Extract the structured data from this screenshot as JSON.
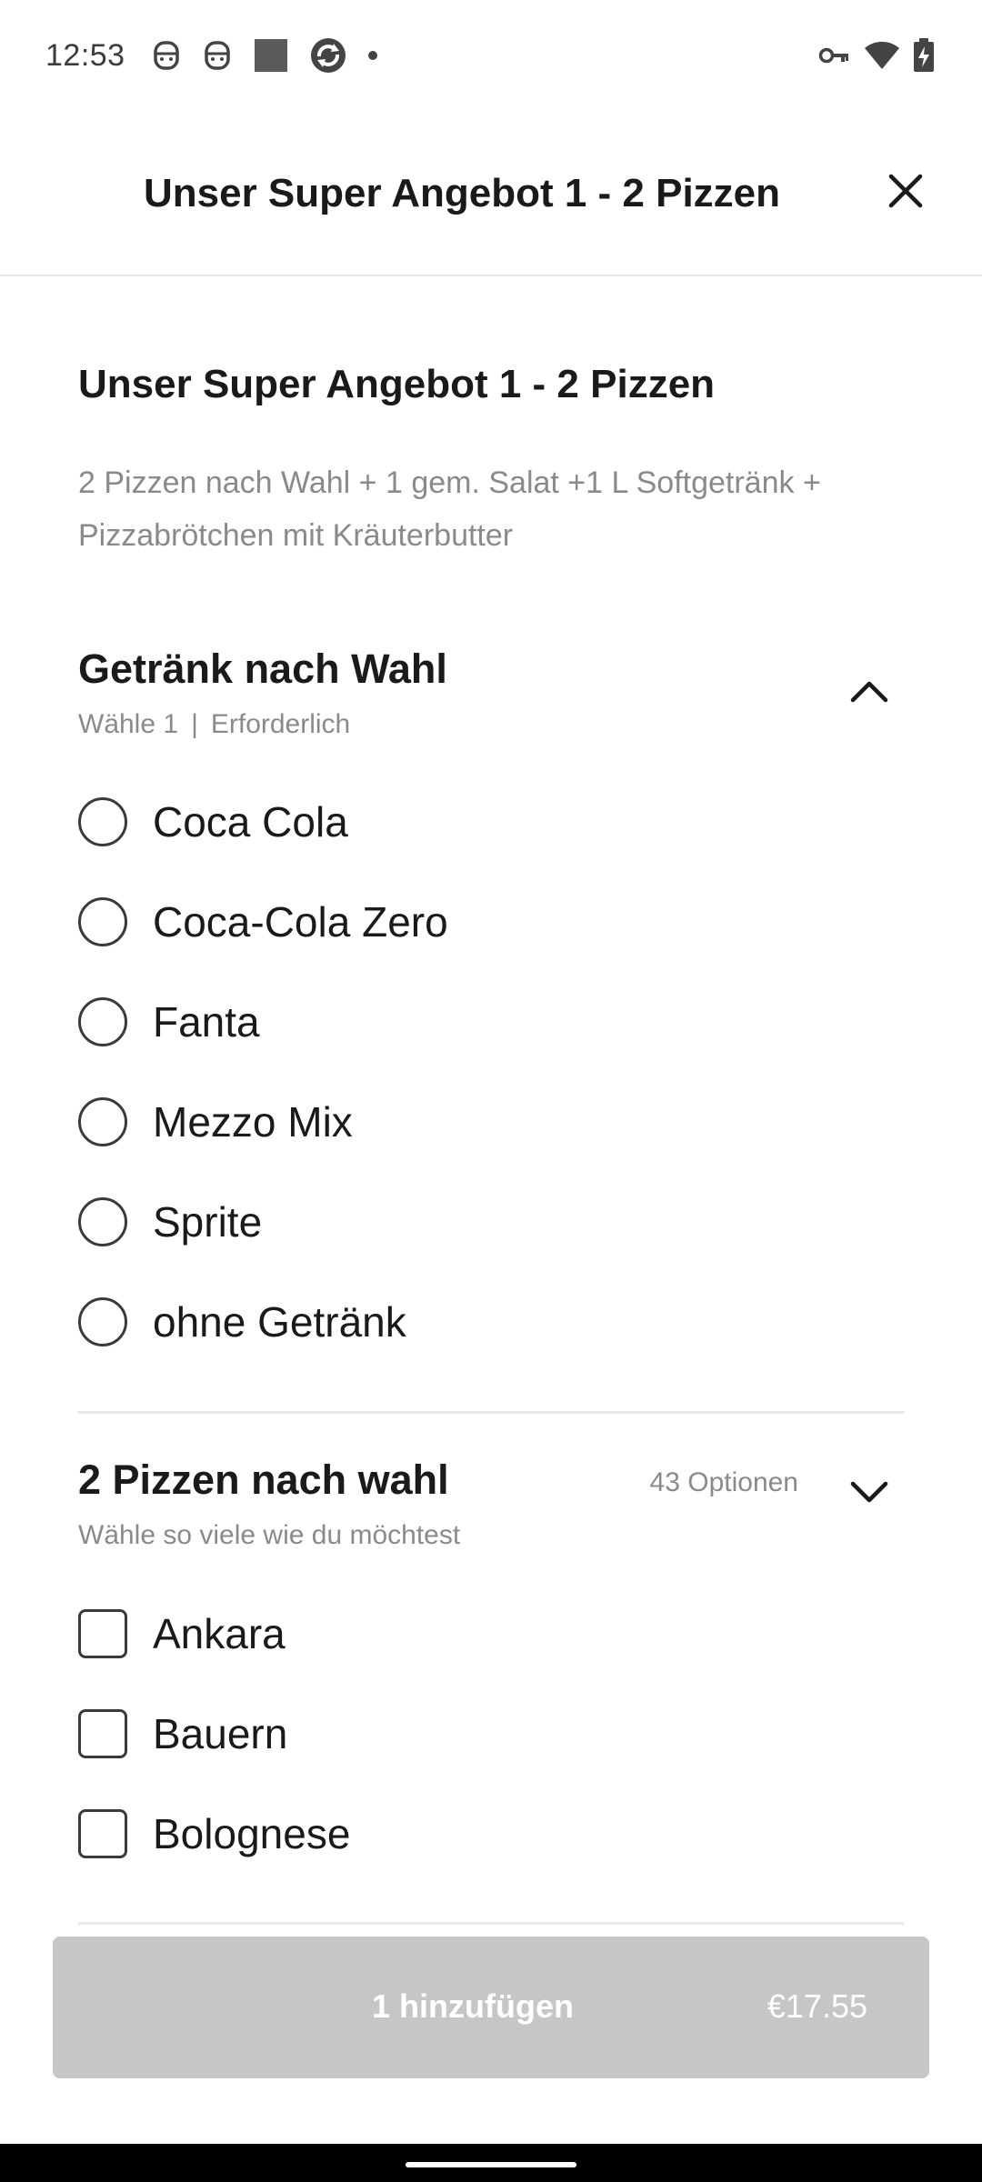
{
  "status_bar": {
    "time": "12:53",
    "left_icons": [
      "tracker-icon",
      "tracker-icon",
      "notification-square-icon",
      "sync-icon",
      "dot-icon"
    ],
    "right_icons": [
      "vpn-key-icon",
      "wifi-icon",
      "battery-charging-icon"
    ]
  },
  "header": {
    "title": "Unser Super Angebot 1 - 2 Pizzen",
    "close_icon": "close-icon"
  },
  "item": {
    "title": "Unser Super Angebot 1 - 2 Pizzen",
    "description": "2 Pizzen nach Wahl + 1 gem. Salat +1 L Softgetränk  + Pizzabrötchen mit Kräuterbutter"
  },
  "drinks": {
    "title": "Getränk nach Wahl",
    "choose": "Wähle 1",
    "separator": "|",
    "required": "Erforderlich",
    "chevron": "chevron-up-icon",
    "options": [
      "Coca Cola",
      "Coca-Cola Zero",
      "Fanta",
      "Mezzo Mix",
      "Sprite",
      "ohne Getränk"
    ]
  },
  "pizzas": {
    "title": "2 Pizzen nach wahl",
    "subtitle": "Wähle so viele wie du möchtest",
    "count": "43 Optionen",
    "chevron": "chevron-down-icon",
    "options": [
      "Ankara",
      "Bauern",
      "Bolognese"
    ]
  },
  "add_button": {
    "label": "1 hinzufügen",
    "price": "€17.55"
  },
  "colors": {
    "text": "#1a1a1a",
    "muted": "#8a8a8a",
    "button_disabled": "#c6c6c6",
    "divider": "#e8e8e8"
  }
}
